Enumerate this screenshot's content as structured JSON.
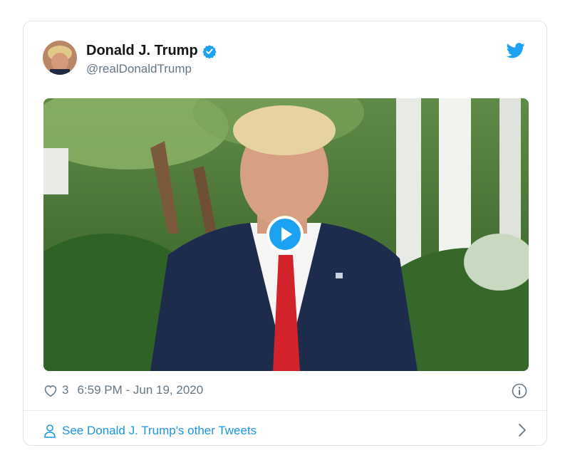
{
  "tweet": {
    "author_name": "Donald J. Trump",
    "author_handle": "@realDonaldTrump",
    "likes": "3",
    "timestamp": "6:59 PM - Jun 19, 2020",
    "footer_link": "See Donald J. Trump's other Tweets"
  },
  "colors": {
    "accent": "#1da1f2",
    "link": "#1b95e0",
    "muted": "#657786"
  },
  "icons": {
    "verified": "verified-badge-icon",
    "brand": "twitter-bird-icon",
    "like": "heart-icon",
    "info": "info-icon",
    "profile": "person-icon",
    "next": "chevron-right-icon",
    "video": "play-icon"
  }
}
